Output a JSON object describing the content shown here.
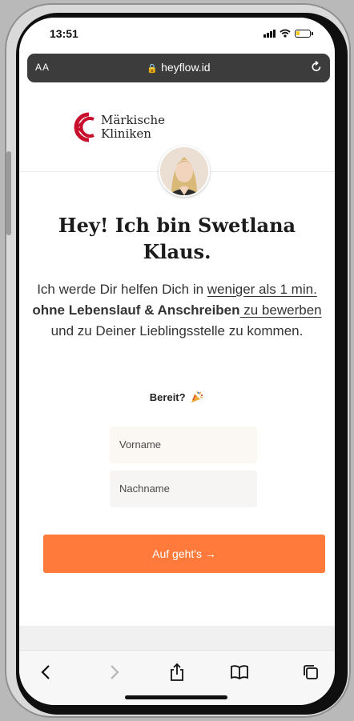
{
  "status_bar": {
    "time": "13:51",
    "battery_level": 0.2
  },
  "browser": {
    "text_size_label": "AA",
    "url": "heyflow.id"
  },
  "header": {
    "logo_line1": "Märkische",
    "logo_line2": "Kliniken",
    "brand_color": "#c8102e"
  },
  "hero": {
    "headline": "Hey! Ich bin Swetlana Klaus.",
    "intro_1": "Ich werde Dir helfen Dich in ",
    "intro_2": "weniger als 1 min.",
    "intro_3": " ",
    "intro_4": "ohne Lebenslauf & Anschreiben",
    "intro_5": " zu bewerben",
    "intro_6": " und zu Deiner Lieblingsstelle zu kommen.",
    "ready": "Bereit?"
  },
  "form": {
    "first_name_placeholder": "Vorname",
    "last_name_placeholder": "Nachname",
    "submit_label": "Auf geht's  →",
    "accent_color": "#ff7a3b"
  },
  "toolbar": {
    "icons": [
      "back-icon",
      "forward-icon",
      "share-icon",
      "bookmarks-icon",
      "tabs-icon"
    ]
  }
}
